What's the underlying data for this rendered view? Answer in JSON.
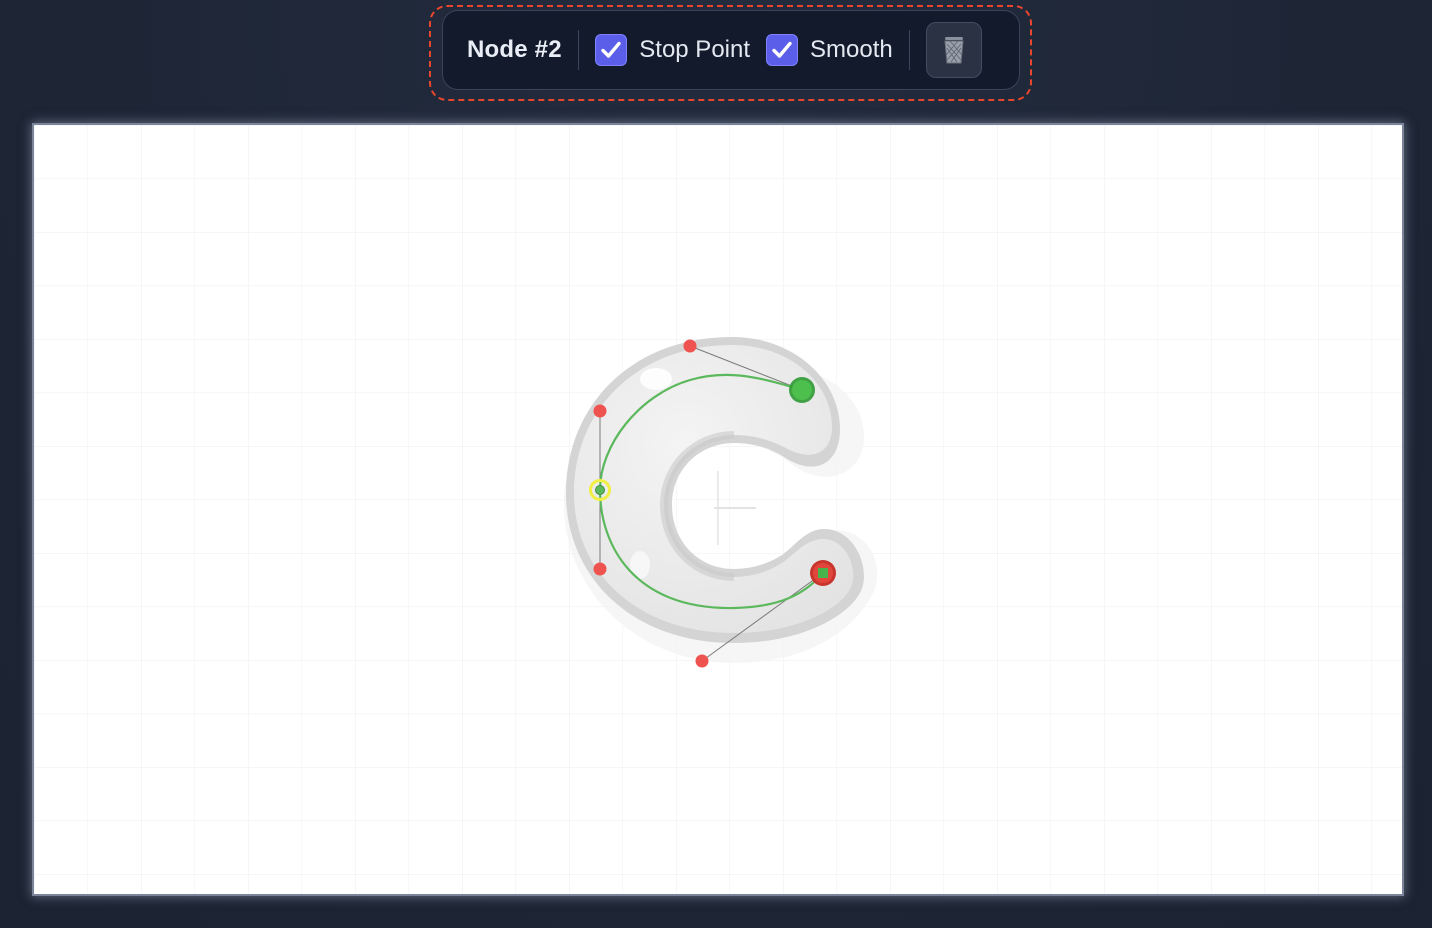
{
  "toolbar": {
    "node_label": "Node #2",
    "stop_point": {
      "label": "Stop Point",
      "checked": true
    },
    "smooth": {
      "label": "Smooth",
      "checked": true
    },
    "delete_icon": "trash-icon"
  },
  "canvas": {
    "glyph_icon": "letter-c-shape",
    "colors": {
      "path": "#5cb85c",
      "start_node": "#4cbf4c",
      "end_node": "#e2453c",
      "selected_node": "#f1ee44",
      "control_handle": "#ef5350",
      "checkbox_accent": "#5b5ee8",
      "highlight_border": "#e8472e"
    }
  }
}
